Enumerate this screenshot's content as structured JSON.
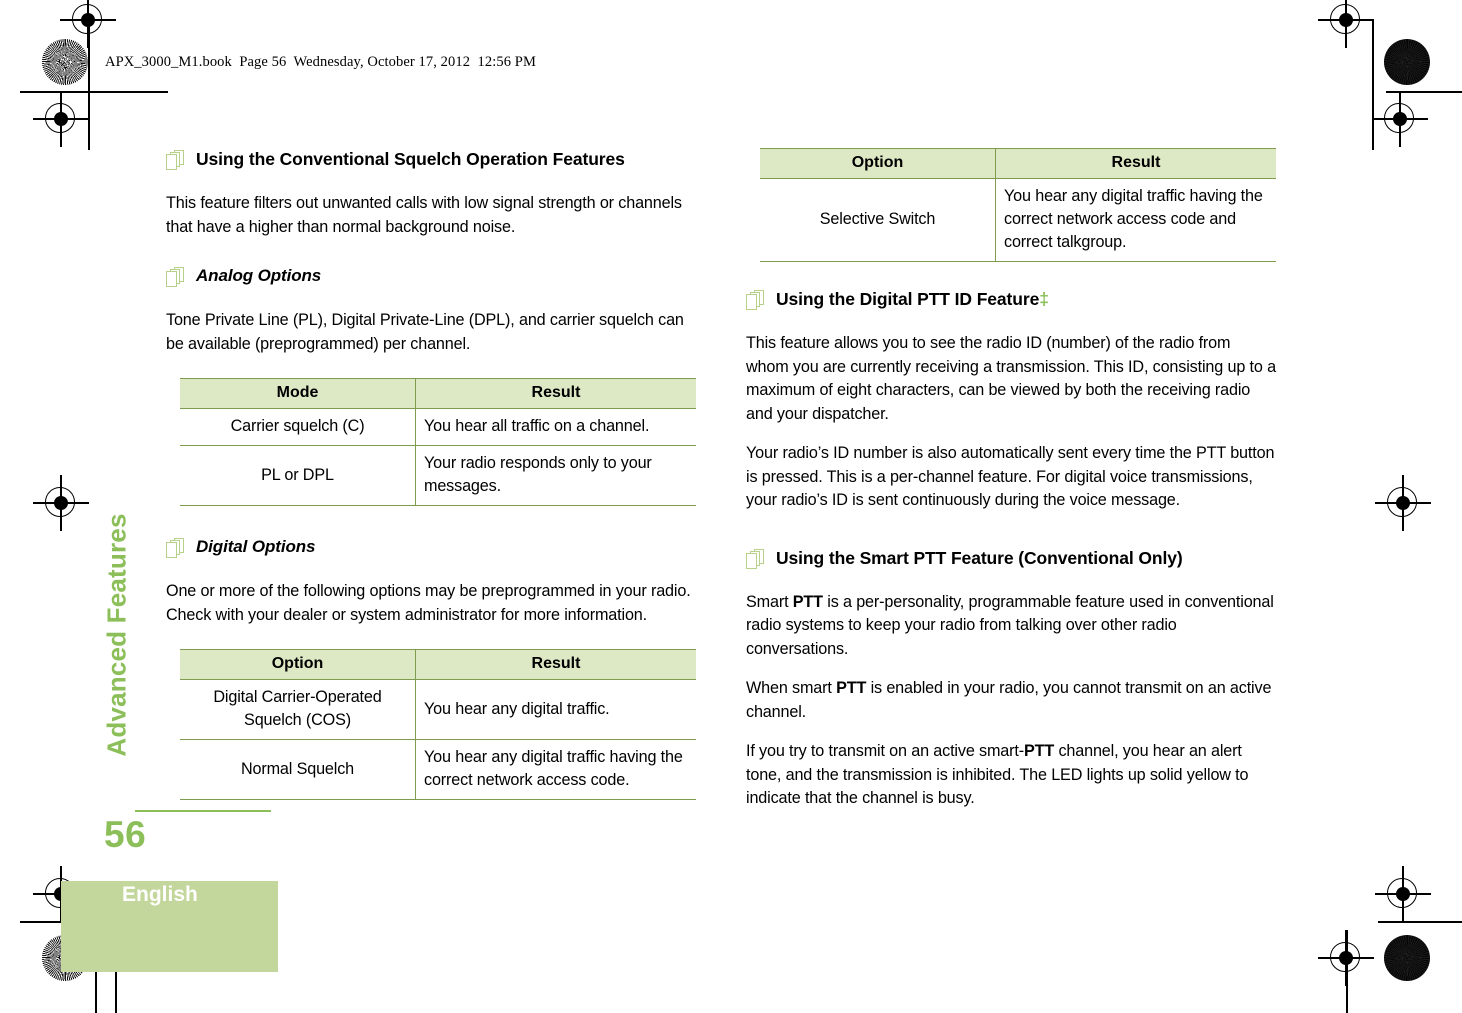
{
  "page": {
    "filestamp": "APX_3000_M1.book  Page 56  Wednesday, October 17, 2012  12:56 PM",
    "side_tab_label": "Advanced Features",
    "page_number": "56",
    "language": "English",
    "accent_green": "#8cbf5a",
    "table_header_bg": "#dde8c4",
    "table_border": "#7e9b4e",
    "language_block_bg": "#c3d69b"
  },
  "left_column": {
    "heading": "Using the Conventional Squelch Operation Features",
    "intro": "This feature filters out unwanted calls with low signal strength or channels that have a higher than normal background noise.",
    "analog": {
      "subheading": "Analog Options",
      "paragraph": "Tone Private Line (PL), Digital Private-Line (DPL), and carrier squelch can be available (preprogrammed) per channel.",
      "table": {
        "headers": [
          "Mode",
          "Result"
        ],
        "rows": [
          [
            "Carrier squelch (C)",
            "You hear all traffic on a channel."
          ],
          [
            "PL or DPL",
            "Your radio responds only to your messages."
          ]
        ]
      }
    },
    "digital": {
      "subheading": "Digital Options",
      "paragraph": "One or more of the following options may be preprogrammed in your radio. Check with your dealer or system administrator for more information.",
      "table": {
        "headers": [
          "Option",
          "Result"
        ],
        "rows": [
          [
            "Digital Carrier-Operated Squelch (COS)",
            "You hear any digital traffic."
          ],
          [
            "Normal Squelch",
            "You hear any digital traffic having the correct network access code."
          ]
        ]
      }
    }
  },
  "right_column": {
    "continued_table": {
      "headers": [
        "Option",
        "Result"
      ],
      "rows": [
        [
          "Selective Switch",
          "You hear any digital traffic having the correct network access code and correct talkgroup."
        ]
      ]
    },
    "ptt_id": {
      "heading": "Using the Digital PTT ID Feature",
      "heading_mark": "‡",
      "paragraph1": "This feature allows you to see the radio ID (number) of the radio from whom you are currently receiving a transmission. This ID, consisting up to a maximum of eight characters, can be viewed by both the receiving radio and your dispatcher.",
      "paragraph2": "Your radio’s ID number is also automatically sent every time the PTT button is pressed. This is a per-channel feature. For digital voice transmissions, your radio’s ID is sent continuously during the voice message."
    },
    "smart_ptt": {
      "heading": "Using the Smart PTT Feature (Conventional Only)",
      "paragraph1_a": "Smart ",
      "paragraph1_b": "PTT",
      "paragraph1_c": " is a per-personality, programmable feature used in conventional radio systems to keep your radio from talking over other radio conversations.",
      "paragraph2_a": "When smart ",
      "paragraph2_b": "PTT",
      "paragraph2_c": " is enabled in your radio, you cannot transmit on an active channel.",
      "paragraph3_a": "If you try to transmit on an active smart-",
      "paragraph3_b": "PTT",
      "paragraph3_c": " channel, you hear an alert tone, and the transmission is inhibited. The LED lights up solid yellow to indicate that the channel is busy."
    }
  }
}
